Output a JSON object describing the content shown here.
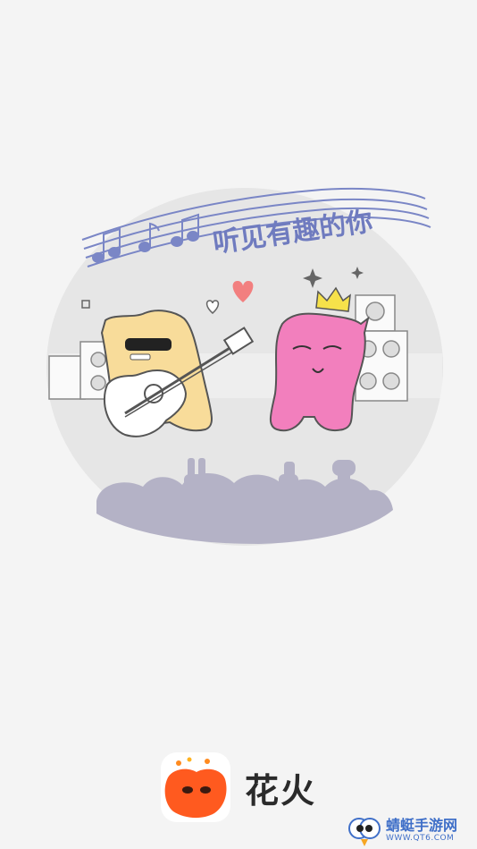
{
  "splash": {
    "slogan": "听见有趣的你"
  },
  "brand": {
    "app_name": "花火",
    "accent_color": "#ff5a1f"
  },
  "watermark": {
    "title": "蜻蜓手游网",
    "url": "WWW.QT6.COM"
  },
  "colors": {
    "background": "#f4f4f4",
    "circle": "#e6e6e6",
    "audience": "#b4b2c6",
    "yellow_monster": "#f8dc9a",
    "pink_monster": "#f27fbd",
    "staff_lines": "#7a86c6"
  }
}
